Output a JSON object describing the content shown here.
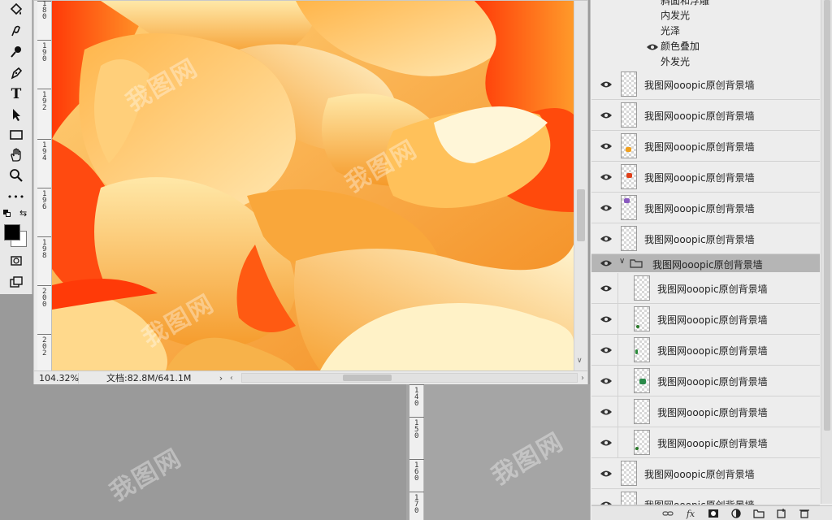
{
  "toolbar": {
    "tools": [
      {
        "name": "paint-bucket-icon",
        "glyph": ""
      },
      {
        "name": "pen-curvature-icon",
        "glyph": ""
      },
      {
        "name": "dodge-icon",
        "glyph": ""
      },
      {
        "name": "pen-icon",
        "glyph": ""
      },
      {
        "name": "type-icon",
        "glyph": "T"
      },
      {
        "name": "path-selection-icon",
        "glyph": ""
      },
      {
        "name": "rectangle-icon",
        "glyph": ""
      },
      {
        "name": "hand-icon",
        "glyph": ""
      },
      {
        "name": "zoom-icon",
        "glyph": ""
      },
      {
        "name": "more-tools-icon",
        "glyph": "•••"
      }
    ],
    "foreground_color": "#000000",
    "background_color": "#ffffff"
  },
  "ruler": {
    "labels": [
      "180",
      "190",
      "192",
      "194",
      "196",
      "198",
      "200",
      "202"
    ]
  },
  "ruler2": {
    "labels": [
      "140",
      "150",
      "160",
      "170"
    ]
  },
  "status": {
    "zoom": "104.32%",
    "doc_size": "文档:82.8M/641.1M",
    "arrow": "›"
  },
  "layers": {
    "effects": [
      "斜面和浮雕",
      "内发光",
      "光泽",
      "颜色叠加",
      "外发光"
    ],
    "rows_top": [
      {
        "name": "我图网ooopic原创背景墙",
        "icon": "blank"
      },
      {
        "name": "我图网ooopic原创背景墙",
        "icon": "blank"
      },
      {
        "name": "我图网ooopic原创背景墙",
        "icon": "flower-orange"
      },
      {
        "name": "我图网ooopic原创背景墙",
        "icon": "flower-red"
      },
      {
        "name": "我图网ooopic原创背景墙",
        "icon": "flower-purple"
      },
      {
        "name": "我图网ooopic原创背景墙",
        "icon": "blank"
      }
    ],
    "group": {
      "name": "我图网ooopic原创背景墙"
    },
    "rows_group": [
      {
        "name": "我图网ooopic原创背景墙",
        "icon": "blank"
      },
      {
        "name": "我图网ooopic原创背景墙",
        "icon": "leaf-small"
      },
      {
        "name": "我图网ooopic原创背景墙",
        "icon": "leaf-green"
      },
      {
        "name": "我图网ooopic原创背景墙",
        "icon": "leaf-cluster"
      },
      {
        "name": "我图网ooopic原创背景墙",
        "icon": "blank"
      },
      {
        "name": "我图网ooopic原创背景墙",
        "icon": "leaf-small"
      }
    ],
    "rows_bottom": [
      {
        "name": "我图网ooopic原创背景墙",
        "icon": "blank"
      },
      {
        "name": "我图网ooopic原创背景墙",
        "icon": "blank"
      }
    ],
    "footer": [
      "link-icon",
      "fx",
      "mask-icon",
      "adjustment-icon",
      "folder-icon",
      "new-layer-icon",
      "trash-icon"
    ]
  },
  "watermark": "我图网"
}
